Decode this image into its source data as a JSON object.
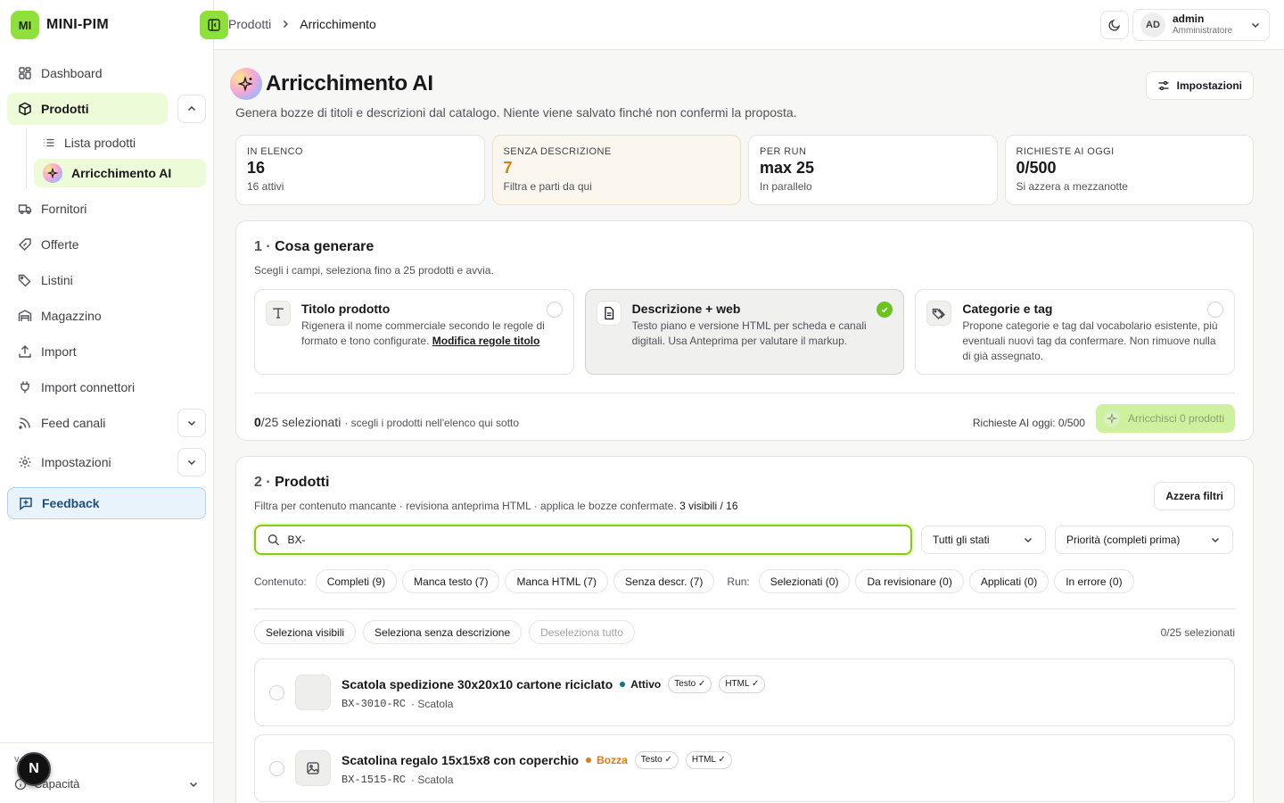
{
  "brand": {
    "logo": "MI",
    "name": "MINI-PIM"
  },
  "sidebar": {
    "items": [
      {
        "label": "Dashboard",
        "icon": "dashboard-icon"
      },
      {
        "label": "Prodotti",
        "icon": "box-icon"
      },
      {
        "label": "Fornitori",
        "icon": "truck-icon"
      },
      {
        "label": "Offerte",
        "icon": "percent-tag-icon"
      },
      {
        "label": "Listini",
        "icon": "tags-icon"
      },
      {
        "label": "Magazzino",
        "icon": "warehouse-icon"
      },
      {
        "label": "Import",
        "icon": "upload-icon"
      },
      {
        "label": "Import connettori",
        "icon": "plug-icon"
      },
      {
        "label": "Feed canali",
        "icon": "rss-icon"
      },
      {
        "label": "Impostazioni",
        "icon": "gear-icon"
      },
      {
        "label": "Feedback",
        "icon": "message-plus-icon"
      }
    ],
    "sub": [
      {
        "label": "Lista prodotti"
      },
      {
        "label": "Arricchimento AI"
      }
    ],
    "footer": {
      "version": "v",
      "label": "Capacità",
      "badge": "N"
    }
  },
  "topbar": {
    "crumbs": [
      "Prodotti",
      "Arricchimento"
    ],
    "user": {
      "initials": "AD",
      "name": "admin",
      "role": "Amministratore"
    }
  },
  "page": {
    "title": "Arricchimento AI",
    "subtitle": "Genera bozze di titoli e descrizioni dal catalogo. Niente viene salvato finché non confermi la proposta.",
    "settings_label": "Impostazioni"
  },
  "stats": [
    {
      "label": "IN ELENCO",
      "value": "16",
      "hint": "16 attivi"
    },
    {
      "label": "SENZA DESCRIZIONE",
      "value": "7",
      "hint": "Filtra e parti da qui"
    },
    {
      "label": "PER RUN",
      "value": "max 25",
      "hint": "In parallelo"
    },
    {
      "label": "RICHIESTE AI OGGI",
      "value": "0/500",
      "hint": "Si azzera a mezzanotte"
    }
  ],
  "section1": {
    "num": "1 ·",
    "title": "Cosa generare",
    "sub": "Scegli i campi, seleziona fino a 25 prodotti e avvia.",
    "options": [
      {
        "title": "Titolo prodotto",
        "desc": "Rigenera il nome commerciale secondo le regole di formato e tono configurate.",
        "link": "Modifica regole titolo",
        "checked": false
      },
      {
        "title": "Descrizione + web",
        "desc": "Testo piano e versione HTML per scheda e canali digitali. Usa Anteprima per valutare il markup.",
        "checked": true
      },
      {
        "title": "Categorie e tag",
        "desc": "Propone categorie e tag dal vocabolario esistente, più eventuali nuovi tag da confermare. Non rimuove nulla di già assegnato.",
        "checked": false
      }
    ],
    "selected_num": "0",
    "selected_total": "/25 selezionati",
    "selected_note": "· scegli i prodotti nell'elenco qui sotto",
    "quota": "Richieste AI oggi: 0/500",
    "enrich_label": "Arricchisci 0 prodotti"
  },
  "section2": {
    "num": "2 ·",
    "title": "Prodotti",
    "sub": "Filtra per contenuto mancante · revisiona anteprima HTML · applica le bozze confermate.",
    "sub_count": "3 visibili / 16",
    "reset_label": "Azzera filtri",
    "search_value": "BX-",
    "status_select": "Tutti gli stati",
    "sort_select": "Priorità (completi prima)",
    "content_label": "Contenuto:",
    "content_chips": [
      "Completi (9)",
      "Manca testo (7)",
      "Manca HTML (7)",
      "Senza descr. (7)"
    ],
    "run_label": "Run:",
    "run_chips": [
      "Selezionati (0)",
      "Da revisionare (0)",
      "Applicati (0)",
      "In errore (0)"
    ],
    "actions": [
      "Seleziona visibili",
      "Seleziona senza descrizione",
      "Deseleziona tutto"
    ],
    "selected_right": "0/25 selezionati",
    "rows": [
      {
        "name": "Scatola spedizione 30x20x10 cartone riciclato",
        "status": "Attivo",
        "status_color": "#0e7490",
        "tags": [
          "Testo ✓",
          "HTML ✓"
        ],
        "sku": "BX-3010-RC",
        "category": "· Scatola"
      },
      {
        "name": "Scatolina regalo 15x15x8 con coperchio",
        "status": "Bozza",
        "status_color": "#e07a12",
        "tags": [
          "Testo ✓",
          "HTML ✓"
        ],
        "sku": "BX-1515-RC",
        "category": "· Scatola"
      }
    ]
  },
  "colors": {
    "accent": "#8ee03a",
    "active_bg": "#eefbd9",
    "warn": "#e07a12",
    "feedback": "#1e4e79"
  }
}
